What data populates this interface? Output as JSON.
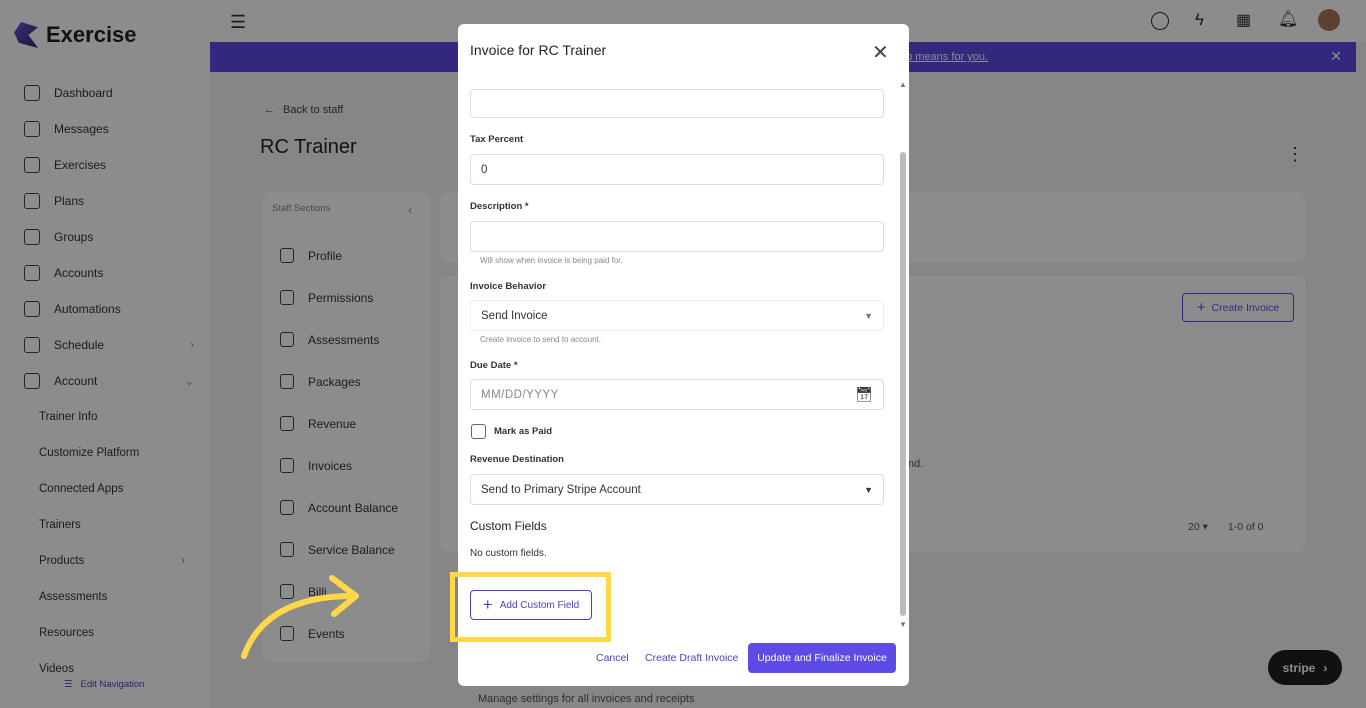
{
  "brand": {
    "name": "Exercise"
  },
  "sidebar": {
    "items": [
      {
        "label": "Dashboard"
      },
      {
        "label": "Messages"
      },
      {
        "label": "Exercises"
      },
      {
        "label": "Plans"
      },
      {
        "label": "Groups"
      },
      {
        "label": "Accounts"
      },
      {
        "label": "Automations"
      },
      {
        "label": "Schedule"
      },
      {
        "label": "Account"
      }
    ],
    "sub_items": [
      {
        "label": "Trainer Info"
      },
      {
        "label": "Customize Platform"
      },
      {
        "label": "Connected Apps"
      },
      {
        "label": "Trainers"
      },
      {
        "label": "Products"
      },
      {
        "label": "Assessments"
      },
      {
        "label": "Resources"
      },
      {
        "label": "Videos"
      }
    ],
    "edit_navigation": "Edit Navigation"
  },
  "banner": {
    "link_text": "rip means for you."
  },
  "page": {
    "back_label": "Back to staff",
    "title": "RC Trainer",
    "staff_sections_label": "Staff Sections",
    "staff_sections": [
      {
        "label": "Profile"
      },
      {
        "label": "Permissions"
      },
      {
        "label": "Assessments"
      },
      {
        "label": "Packages"
      },
      {
        "label": "Revenue"
      },
      {
        "label": "Invoices"
      },
      {
        "label": "Account Balance"
      },
      {
        "label": "Service Balance"
      },
      {
        "label": "Billi"
      },
      {
        "label": "Events"
      }
    ],
    "create_invoice": "Create Invoice",
    "partial_text": "nd.",
    "pager": {
      "per_page": "20",
      "range": "1-0 of 0"
    },
    "footer_text": "Manage settings for all invoices and receipts"
  },
  "stripe_button": {
    "label": "stripe"
  },
  "modal": {
    "title": "Invoice for RC Trainer",
    "tax_percent": {
      "label": "Tax Percent",
      "value": "0"
    },
    "description": {
      "label": "Description *",
      "value": "",
      "hint": "Will show when invoice is being paid for."
    },
    "invoice_behavior": {
      "label": "Invoice Behavior",
      "value": "Send Invoice",
      "hint": "Create invoice to send to account."
    },
    "due_date": {
      "label": "Due Date *",
      "placeholder": "MM/DD/YYYY"
    },
    "mark_as_paid": {
      "label": "Mark as Paid"
    },
    "revenue_destination": {
      "label": "Revenue Destination",
      "value": "Send to Primary Stripe Account"
    },
    "custom_fields": {
      "heading": "Custom Fields",
      "empty_text": "No custom fields.",
      "add_button": "Add Custom Field"
    },
    "footer": {
      "cancel": "Cancel",
      "create_draft": "Create Draft Invoice",
      "finalize": "Update and Finalize Invoice"
    }
  },
  "colors": {
    "accent": "#5b4ce6",
    "highlight": "#ffd84a"
  }
}
